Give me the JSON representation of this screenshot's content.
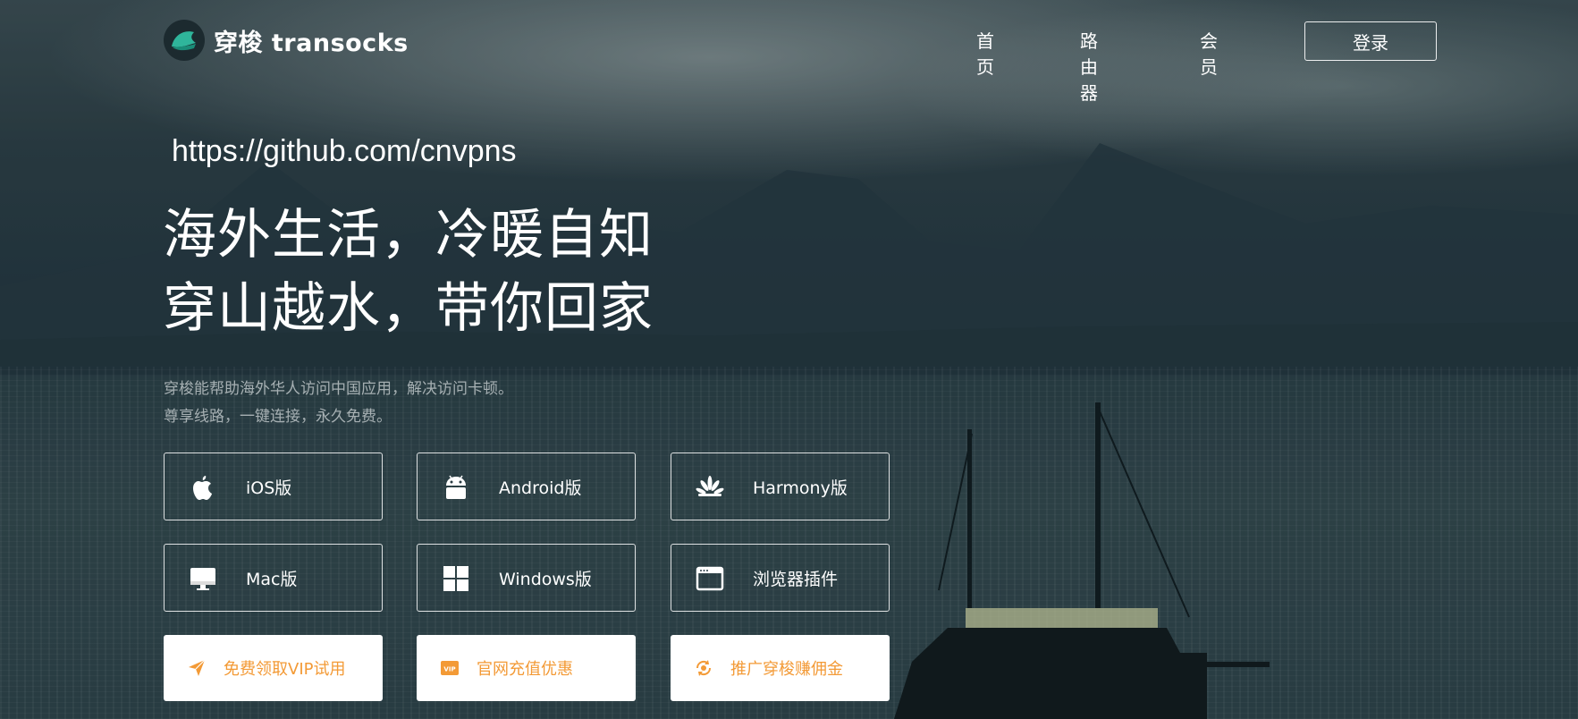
{
  "brand": {
    "name": "穿梭 transocks"
  },
  "nav": {
    "items": [
      {
        "label": "首页"
      },
      {
        "label": "路由器"
      },
      {
        "label": "会员"
      }
    ],
    "login_label": "登录"
  },
  "hero": {
    "url": "https://github.com/cnvpns",
    "headline_line1": "海外生活，冷暖自知",
    "headline_line2": "穿山越水，带你回家",
    "subtitle_line1": "穿梭能帮助海外华人访问中国应用，解决访问卡顿。",
    "subtitle_line2": "尊享线路，一键连接，永久免费。"
  },
  "downloads": [
    {
      "label": "iOS版",
      "icon": "apple-icon"
    },
    {
      "label": "Android版",
      "icon": "android-icon"
    },
    {
      "label": "Harmony版",
      "icon": "huawei-icon"
    },
    {
      "label": "Mac版",
      "icon": "monitor-icon"
    },
    {
      "label": "Windows版",
      "icon": "windows-icon"
    },
    {
      "label": "浏览器插件",
      "icon": "browser-window-icon"
    }
  ],
  "promos": [
    {
      "label": "免费领取VIP试用",
      "icon": "paper-plane-icon"
    },
    {
      "label": "官网充值优惠",
      "icon": "vip-badge-icon"
    },
    {
      "label": "推广穿梭赚佣金",
      "icon": "refresh-coin-icon"
    }
  ],
  "colors": {
    "accent_orange": "#f39a36",
    "logo_teal": "#2fb59b",
    "background_dark": "#263843"
  }
}
